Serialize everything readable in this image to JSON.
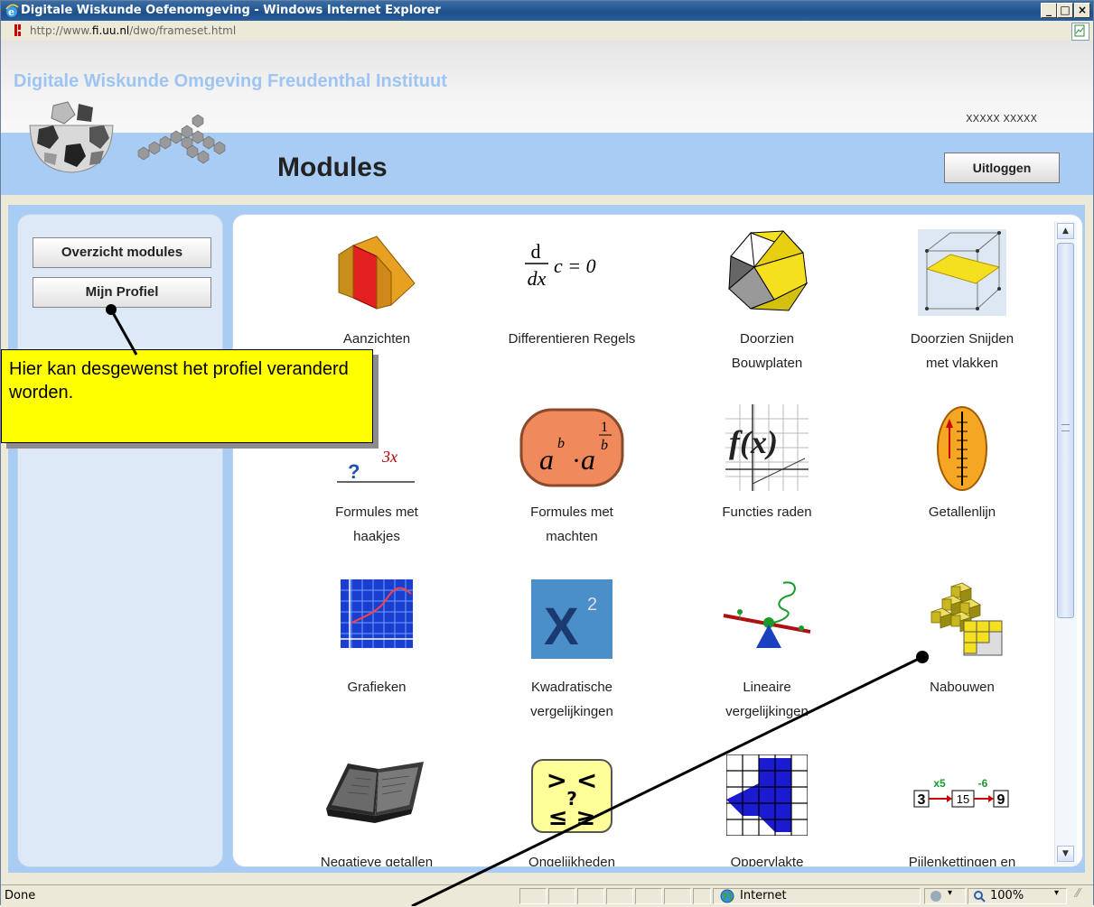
{
  "window": {
    "title": "Digitale Wiskunde Oefenomgeving - Windows Internet Explorer"
  },
  "address": {
    "url_prefix": "http://www.",
    "url_domain": "fi.uu.nl",
    "url_path": "/dwo/frameset.html"
  },
  "header": {
    "site_title": "Digitale Wiskunde Omgeving  Freudenthal Instituut",
    "user_name": "XXXXX XXXXX",
    "page_title": "Modules",
    "logout_label": "Uitloggen"
  },
  "sidebar": {
    "items": [
      {
        "label": "Overzicht modules"
      },
      {
        "label": "Mijn Profiel"
      }
    ]
  },
  "modules": [
    {
      "label": "Aanzichten",
      "icon": "aanzichten-icon"
    },
    {
      "label": "Differentieren Regels",
      "icon": "derivative-formula-icon"
    },
    {
      "label": "Doorzien\nBouwplaten",
      "icon": "polyhedron-icon"
    },
    {
      "label": "Doorzien Snijden\nmet vlakken",
      "icon": "cube-plane-icon"
    },
    {
      "label": "Formules met\nhaakjes",
      "icon": "formula-brackets-icon"
    },
    {
      "label": "Formules met\nmachten",
      "icon": "powers-icon"
    },
    {
      "label": "Functies raden",
      "icon": "fx-graph-icon"
    },
    {
      "label": "Getallenlijn",
      "icon": "number-line-icon"
    },
    {
      "label": "Grafieken",
      "icon": "graph-icon"
    },
    {
      "label": "Kwadratische\nvergelijkingen",
      "icon": "x-squared-icon"
    },
    {
      "label": "Lineaire\nvergelijkingen",
      "icon": "balance-icon"
    },
    {
      "label": "Nabouwen",
      "icon": "blocks-icon"
    },
    {
      "label": "Negatieve getallen",
      "icon": "book-icon"
    },
    {
      "label": "Ongelijkheden",
      "icon": "inequality-icon"
    },
    {
      "label": "Oppervlakte",
      "icon": "grid-area-icon"
    },
    {
      "label": "Pijlenkettingen en",
      "icon": "arrow-chain-icon"
    }
  ],
  "formula_text": {
    "d": "d",
    "dx": "dx",
    "rhs": "c = 0",
    "three_x": "3x",
    "q": "?",
    "a": "a",
    "b": "b",
    "one": "1",
    "fx": "f(x)",
    "x": "X",
    "two": "2",
    "ineq_top": "> <",
    "ineq_mid": "?",
    "ineq_bot": "≤ ≥",
    "chain_a": "3",
    "chain_b": "15",
    "chain_c": "9",
    "chain_op1": "x5",
    "chain_op2": "-6"
  },
  "callout": {
    "text": "Hier kan desgewenst het profiel veranderd worden."
  },
  "status": {
    "left": "Done",
    "zone": "Internet",
    "zoom": "100%"
  },
  "colors": {
    "band": "#a9ccf4",
    "callout": "#ffff00"
  }
}
